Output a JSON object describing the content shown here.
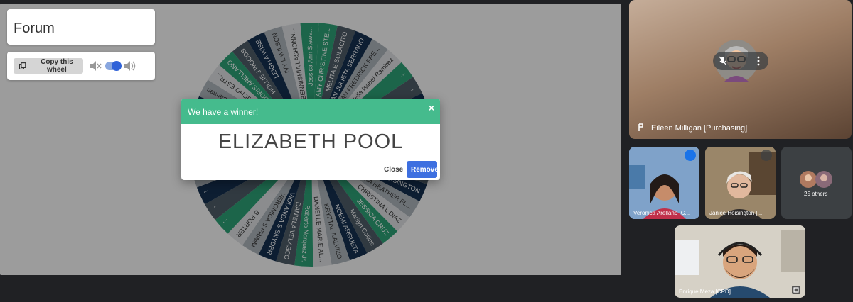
{
  "wheel_page": {
    "title": "Forum",
    "copy_button": "Copy this wheel",
    "entries": [
      "AMY CHRISTINE STE...",
      "MELITA E SOLACITO",
      "AN JULIETA SERRANO",
      "TRYAN FREDRICK FRE...",
      "Stella Isabel Ramirez",
      "...",
      "...",
      "...",
      "...",
      "...",
      "...",
      "ANDELL MA...",
      "ACE HOISINGTON",
      "ANNA HEATHER FL...",
      "CHRISTINA L DIAZ",
      "JESSICA CRUZ",
      "Marilyn Collins",
      "NOEMI ARGUETA",
      "KRYZTAL A ALVIZO",
      "DANELLE MARIE AL...",
      "Roberto Norquez Jr.",
      "DANIELA VELASCO",
      "VIOLANDA S SNYDER",
      "VERONICA S PRIMM",
      "B PORTER",
      "...",
      "...",
      "...",
      "...",
      "...",
      "...",
      "...",
      "...",
      "Erin R Carmen",
      "MICHO ESTR...",
      "DORIS ARELLANO",
      "HOLLIE J WOODS",
      "LEIGH A WISE",
      "IVY L WILSON",
      "BENNISHIA LASHONN...",
      "Jessica Ann Stewa..."
    ]
  },
  "modal": {
    "header": "We have a winner!",
    "close_x": "×",
    "winner": "ELIZABETH POOL",
    "close_button": "Close",
    "remove_button": "Remove"
  },
  "meet": {
    "main_tile": {
      "name": "Eileen Milligan [Purchasing]"
    },
    "tiles": [
      {
        "name": "Veronica Arellano [C..."
      },
      {
        "name": "Janice Hoisington [..."
      },
      {
        "name": "25 others"
      },
      {
        "name": "Enrique Meza [CPD]"
      }
    ]
  },
  "colors": {
    "wheel": [
      "#2d9e74",
      "#4d5b66",
      "#15304f",
      "#a9b1b8",
      "#d9dcdf"
    ],
    "modal_header": "#45bb8d",
    "remove_button": "#3d6fe0"
  }
}
